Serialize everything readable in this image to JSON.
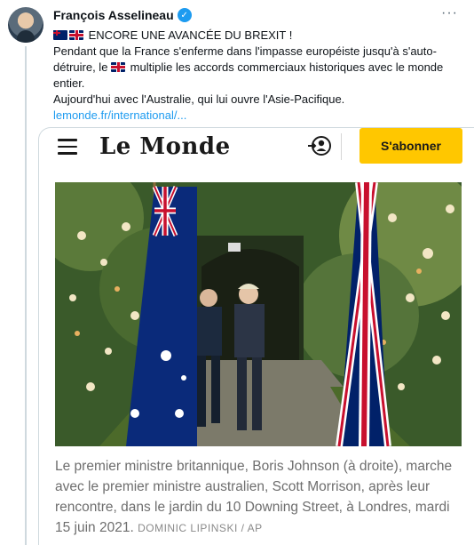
{
  "tweet": {
    "author_name": "François Asselineau",
    "verified_glyph": "✓",
    "more_glyph": "···",
    "line1": "ENCORE UNE AVANCÉE DU BREXIT !",
    "line2_part1": "Pendant que la France s'enferme dans l'impasse européiste jusqu'à s'auto-détruire, le",
    "line2_part2": "multiplie les accords commerciaux historiques avec le monde entier.",
    "line3": "Aujourd'hui avec l'Australie, qui lui ouvre l'Asie-Pacifique.",
    "link": "lemonde.fr/international/..."
  },
  "card": {
    "logo": "Le Monde",
    "subscribe_label": "S'abonner",
    "icons": {
      "menu": "hamburger-icon",
      "account": "account-icon"
    },
    "caption": "Le premier ministre britannique, Boris Johnson (à droite), marche avec le premier ministre australien, Scott Morrison, après leur rencontre, dans le jardin du 10 Downing Street, à Londres, mardi 15 juin 2021.",
    "credit": "DOMINIC LIPINSKI / AP"
  },
  "colors": {
    "accent": "#1d9bf0",
    "subscribe_bg": "#ffc700",
    "flag_blue": "#012169",
    "flag_red": "#c8102e"
  }
}
